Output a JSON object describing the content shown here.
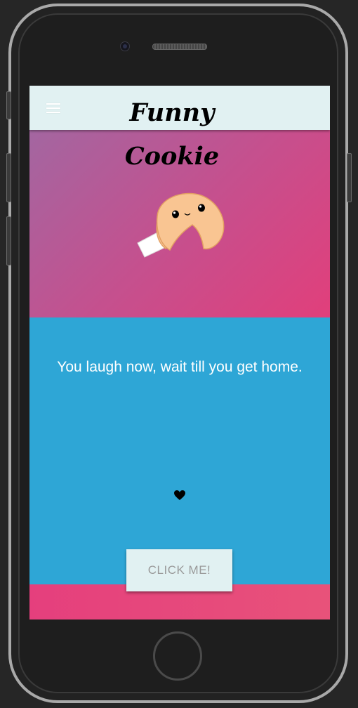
{
  "header": {
    "title_line1": "Funny",
    "title_line2": "Cookie",
    "menu_icon": "hamburger-menu-icon",
    "bar_color": "#e1f1f2"
  },
  "hero": {
    "image": "fortune-cookie-illustration",
    "gradient_colors": [
      "#9d6aa4",
      "#e13f7b"
    ]
  },
  "fortune": {
    "text": "You laugh now, wait till you get home.",
    "background": "#2ea6d6",
    "heart_icon": "heart-icon"
  },
  "action": {
    "button_label": "CLICK ME!"
  }
}
